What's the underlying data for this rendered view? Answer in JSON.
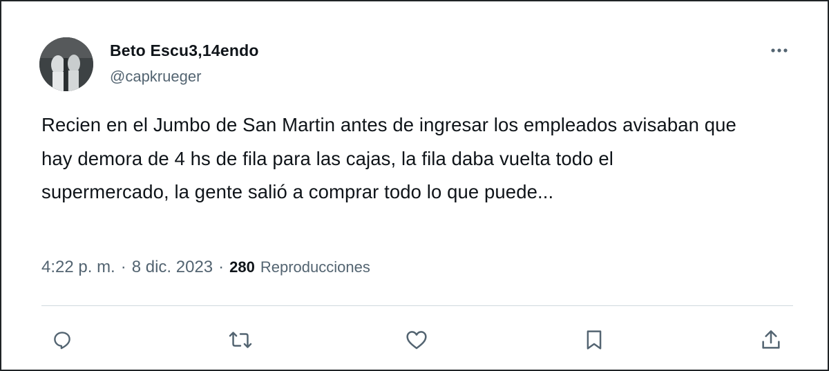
{
  "user": {
    "display_name": "Beto Escu3,14endo",
    "handle": "@capkrueger",
    "avatar_icon": "avatar-photo"
  },
  "menu": {
    "icon": "more-horizontal-icon"
  },
  "tweet": {
    "text": "Recien en el Jumbo de San Martin antes de ingresar los empleados avisaban que hay demora de 4 hs de fila para las cajas, la fila daba vuelta todo el supermercado, la gente salió a comprar todo lo que puede..."
  },
  "meta": {
    "time": "4:22 p. m.",
    "separator": "·",
    "date": "8 dic. 2023",
    "views_count": "280",
    "views_label": "Reproducciones"
  },
  "actions": [
    {
      "name": "reply",
      "icon": "reply-icon"
    },
    {
      "name": "retweet",
      "icon": "retweet-icon"
    },
    {
      "name": "like",
      "icon": "heart-icon"
    },
    {
      "name": "bookmark",
      "icon": "bookmark-icon"
    },
    {
      "name": "share",
      "icon": "share-icon"
    }
  ],
  "colors": {
    "text_primary": "#0f1419",
    "text_secondary": "#536471",
    "divider": "#cfd9de",
    "frame_border": "#1f2326"
  }
}
